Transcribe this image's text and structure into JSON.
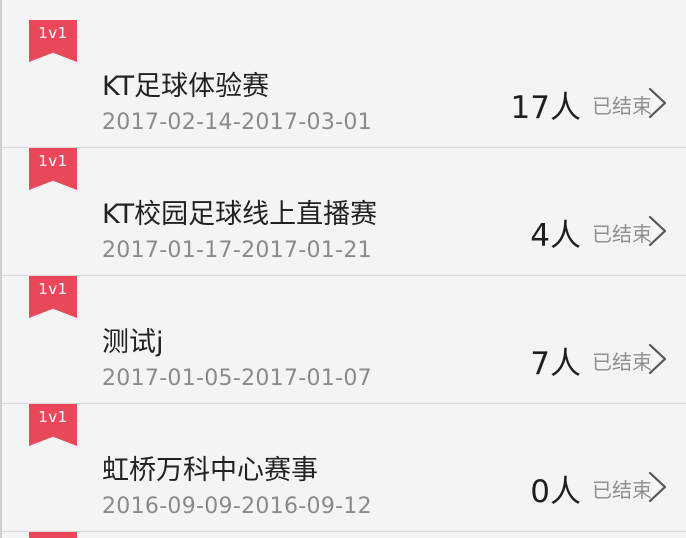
{
  "events": [
    {
      "badge": "1v1",
      "title": "KT足球体验赛",
      "dates": "2017-02-14-2017-03-01",
      "count": "17人",
      "status": "已结束"
    },
    {
      "badge": "1v1",
      "title": "KT校园足球线上直播赛",
      "dates": "2017-01-17-2017-01-21",
      "count": "4人",
      "status": "已结束"
    },
    {
      "badge": "1v1",
      "title": "测试j",
      "dates": "2017-01-05-2017-01-07",
      "count": "7人",
      "status": "已结束"
    },
    {
      "badge": "1v1",
      "title": "虹桥万科中心赛事",
      "dates": "2016-09-09-2016-09-12",
      "count": "0人",
      "status": "已结束"
    }
  ],
  "colors": {
    "ribbon": "#e9485a",
    "background": "#f4f4f4",
    "divider": "#d7d7d7"
  },
  "icons": {
    "chevron": "chevron-right-icon",
    "badge": "ribbon-badge-icon"
  }
}
